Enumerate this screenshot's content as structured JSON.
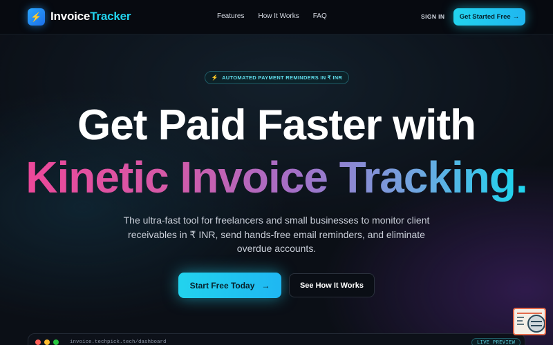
{
  "nav": {
    "brand_part1": "Invoice",
    "brand_part2": "Tracker",
    "logo_icon": "bolt-icon",
    "links": [
      "Features",
      "How It Works",
      "FAQ"
    ],
    "signin_label": "SIGN IN",
    "cta_label": "Get Started Free",
    "cta_arrow": "→"
  },
  "hero": {
    "badge_icon": "⚡",
    "badge_text": "AUTOMATED PAYMENT REMINDERS IN ₹ INR",
    "headline_line1": "Get Paid Faster with",
    "headline_line2": "Kinetic Invoice Tracking",
    "headline_dot": ".",
    "subtitle": "The ultra-fast tool for freelancers and small businesses to monitor client receivables in ₹ INR, send hands-free email reminders, and eliminate overdue accounts.",
    "primary_button": "Start Free Today",
    "primary_arrow": "→",
    "secondary_button": "See How It Works"
  },
  "preview": {
    "url": "invoice.techpick.tech/dashboard",
    "live_badge": "LIVE PREVIEW"
  },
  "colors": {
    "accent": "#22d3ee",
    "gradient_start": "#ec4899",
    "background": "#0b0f16"
  }
}
